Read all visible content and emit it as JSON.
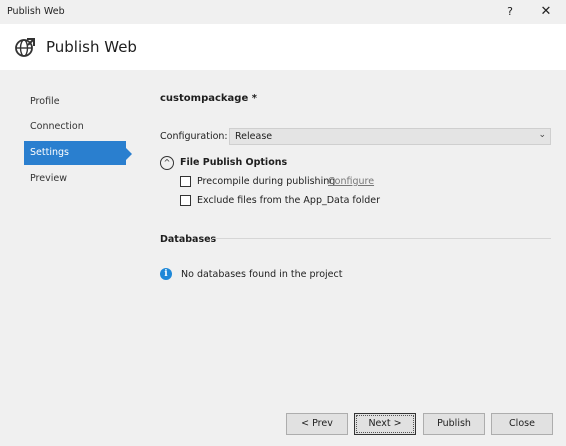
{
  "window": {
    "title": "Publish Web",
    "help_label": "?",
    "close_label": "✕"
  },
  "header": {
    "title": "Publish Web",
    "icon": "globe-publish-icon"
  },
  "sidebar": {
    "items": [
      {
        "label": "Profile"
      },
      {
        "label": "Connection"
      },
      {
        "label": "Settings",
        "active": true
      },
      {
        "label": "Preview"
      }
    ]
  },
  "settings": {
    "profile_name": "custompackage *",
    "configuration_label": "Configuration:",
    "configuration_value": "Release",
    "configuration_chevron": "⌄",
    "file_publish_options_title": "File Publish Options",
    "expander_glyph": "^",
    "precompile_label": "Precompile during publishing",
    "configure_link": "Configure",
    "exclude_label": "Exclude files from the App_Data folder"
  },
  "databases": {
    "title": "Databases",
    "info_glyph": "i",
    "message": "No databases found in the project"
  },
  "footer": {
    "prev_label": "< Prev",
    "next_label": "Next >",
    "publish_label": "Publish",
    "close_label": "Close"
  },
  "colors": {
    "accent": "#2a7fcf",
    "info": "#1e88d8"
  }
}
